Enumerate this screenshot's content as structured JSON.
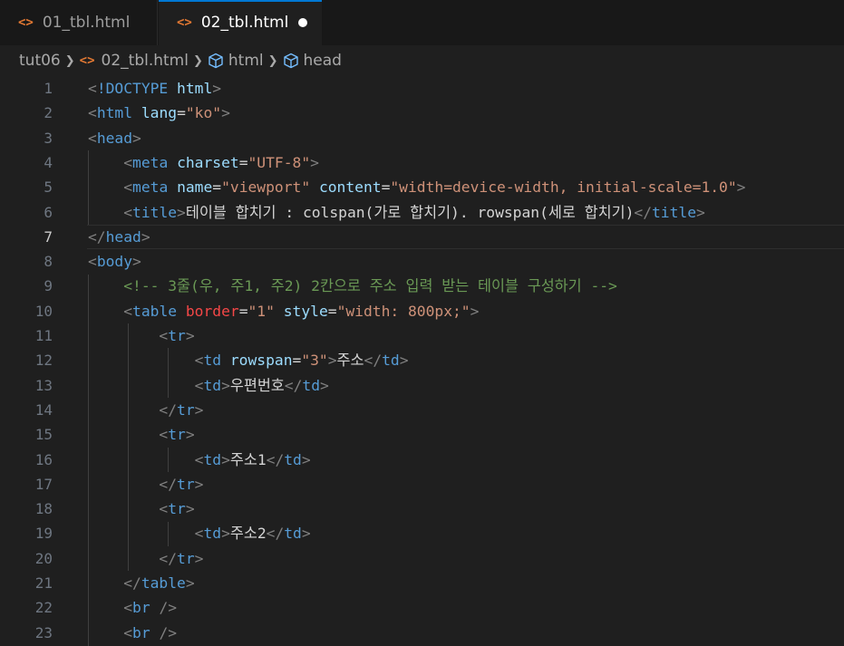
{
  "tabs": [
    {
      "icon": "<>",
      "label": "01_tbl.html",
      "active": false,
      "modified": false
    },
    {
      "icon": "<>",
      "label": "02_tbl.html",
      "active": true,
      "modified": true
    }
  ],
  "breadcrumb": {
    "folder": "tut06",
    "file": "02_tbl.html",
    "symbols": [
      "html",
      "head"
    ]
  },
  "colors": {
    "background": "#1f1f1f",
    "tag": "#569cd6",
    "attribute": "#9cdcfe",
    "string": "#ce9178",
    "comment": "#6a9955",
    "bracket": "#808080",
    "file_icon": "#e37933",
    "symbol_icon": "#75beff"
  },
  "editor": {
    "active_line": 7,
    "lines": [
      {
        "n": "1",
        "tokens": [
          [
            "br",
            "<"
          ],
          [
            "tag",
            "!DOCTYPE"
          ],
          [
            "txt",
            " "
          ],
          [
            "attr",
            "html"
          ],
          [
            "br",
            ">"
          ]
        ]
      },
      {
        "n": "2",
        "tokens": [
          [
            "br",
            "<"
          ],
          [
            "tag",
            "html"
          ],
          [
            "txt",
            " "
          ],
          [
            "attr",
            "lang"
          ],
          [
            "txt",
            "="
          ],
          [
            "str",
            "\"ko\""
          ],
          [
            "br",
            ">"
          ]
        ]
      },
      {
        "n": "3",
        "tokens": [
          [
            "br",
            "<"
          ],
          [
            "tag",
            "head"
          ],
          [
            "br",
            ">"
          ]
        ]
      },
      {
        "n": "4",
        "tokens": [
          [
            "txt",
            "    "
          ],
          [
            "br",
            "<"
          ],
          [
            "tag",
            "meta"
          ],
          [
            "txt",
            " "
          ],
          [
            "attr",
            "charset"
          ],
          [
            "txt",
            "="
          ],
          [
            "str",
            "\"UTF-8\""
          ],
          [
            "br",
            ">"
          ]
        ]
      },
      {
        "n": "5",
        "tokens": [
          [
            "txt",
            "    "
          ],
          [
            "br",
            "<"
          ],
          [
            "tag",
            "meta"
          ],
          [
            "txt",
            " "
          ],
          [
            "attr",
            "name"
          ],
          [
            "txt",
            "="
          ],
          [
            "str",
            "\"viewport\""
          ],
          [
            "txt",
            " "
          ],
          [
            "attr",
            "content"
          ],
          [
            "txt",
            "="
          ],
          [
            "str",
            "\"width=device-width, initial-scale=1.0\""
          ],
          [
            "br",
            ">"
          ]
        ]
      },
      {
        "n": "6",
        "tokens": [
          [
            "txt",
            "    "
          ],
          [
            "br",
            "<"
          ],
          [
            "tag",
            "title"
          ],
          [
            "br",
            ">"
          ],
          [
            "txt",
            "테이블 합치기 : colspan(가로 합치기). rowspan(세로 합치기)"
          ],
          [
            "br",
            "</"
          ],
          [
            "tag",
            "title"
          ],
          [
            "br",
            ">"
          ]
        ]
      },
      {
        "n": "7",
        "tokens": [
          [
            "br",
            "</"
          ],
          [
            "tag",
            "head"
          ],
          [
            "br",
            ">"
          ]
        ]
      },
      {
        "n": "8",
        "tokens": [
          [
            "br",
            "<"
          ],
          [
            "tag",
            "body"
          ],
          [
            "br",
            ">"
          ]
        ]
      },
      {
        "n": "9",
        "tokens": [
          [
            "txt",
            "    "
          ],
          [
            "com",
            "<!-- 3줄(우, 주1, 주2) 2칸으로 주소 입력 받는 테이블 구성하기 -->"
          ]
        ]
      },
      {
        "n": "10",
        "tokens": [
          [
            "txt",
            "    "
          ],
          [
            "br",
            "<"
          ],
          [
            "tag",
            "table"
          ],
          [
            "txt",
            " "
          ],
          [
            "red",
            "border"
          ],
          [
            "txt",
            "="
          ],
          [
            "str",
            "\"1\""
          ],
          [
            "txt",
            " "
          ],
          [
            "attr",
            "style"
          ],
          [
            "txt",
            "="
          ],
          [
            "str",
            "\"width: 800px;\""
          ],
          [
            "br",
            ">"
          ]
        ]
      },
      {
        "n": "11",
        "tokens": [
          [
            "txt",
            "        "
          ],
          [
            "br",
            "<"
          ],
          [
            "tag",
            "tr"
          ],
          [
            "br",
            ">"
          ]
        ]
      },
      {
        "n": "12",
        "tokens": [
          [
            "txt",
            "            "
          ],
          [
            "br",
            "<"
          ],
          [
            "tag",
            "td"
          ],
          [
            "txt",
            " "
          ],
          [
            "attr",
            "rowspan"
          ],
          [
            "txt",
            "="
          ],
          [
            "str",
            "\"3\""
          ],
          [
            "br",
            ">"
          ],
          [
            "txt",
            "주소"
          ],
          [
            "br",
            "</"
          ],
          [
            "tag",
            "td"
          ],
          [
            "br",
            ">"
          ]
        ]
      },
      {
        "n": "13",
        "tokens": [
          [
            "txt",
            "            "
          ],
          [
            "br",
            "<"
          ],
          [
            "tag",
            "td"
          ],
          [
            "br",
            ">"
          ],
          [
            "txt",
            "우편번호"
          ],
          [
            "br",
            "</"
          ],
          [
            "tag",
            "td"
          ],
          [
            "br",
            ">"
          ]
        ]
      },
      {
        "n": "14",
        "tokens": [
          [
            "txt",
            "        "
          ],
          [
            "br",
            "</"
          ],
          [
            "tag",
            "tr"
          ],
          [
            "br",
            ">"
          ]
        ]
      },
      {
        "n": "15",
        "tokens": [
          [
            "txt",
            "        "
          ],
          [
            "br",
            "<"
          ],
          [
            "tag",
            "tr"
          ],
          [
            "br",
            ">"
          ]
        ]
      },
      {
        "n": "16",
        "tokens": [
          [
            "txt",
            "            "
          ],
          [
            "br",
            "<"
          ],
          [
            "tag",
            "td"
          ],
          [
            "br",
            ">"
          ],
          [
            "txt",
            "주소1"
          ],
          [
            "br",
            "</"
          ],
          [
            "tag",
            "td"
          ],
          [
            "br",
            ">"
          ]
        ]
      },
      {
        "n": "17",
        "tokens": [
          [
            "txt",
            "        "
          ],
          [
            "br",
            "</"
          ],
          [
            "tag",
            "tr"
          ],
          [
            "br",
            ">"
          ]
        ]
      },
      {
        "n": "18",
        "tokens": [
          [
            "txt",
            "        "
          ],
          [
            "br",
            "<"
          ],
          [
            "tag",
            "tr"
          ],
          [
            "br",
            ">"
          ]
        ]
      },
      {
        "n": "19",
        "tokens": [
          [
            "txt",
            "            "
          ],
          [
            "br",
            "<"
          ],
          [
            "tag",
            "td"
          ],
          [
            "br",
            ">"
          ],
          [
            "txt",
            "주소2"
          ],
          [
            "br",
            "</"
          ],
          [
            "tag",
            "td"
          ],
          [
            "br",
            ">"
          ]
        ]
      },
      {
        "n": "20",
        "tokens": [
          [
            "txt",
            "        "
          ],
          [
            "br",
            "</"
          ],
          [
            "tag",
            "tr"
          ],
          [
            "br",
            ">"
          ]
        ]
      },
      {
        "n": "21",
        "tokens": [
          [
            "txt",
            "    "
          ],
          [
            "br",
            "</"
          ],
          [
            "tag",
            "table"
          ],
          [
            "br",
            ">"
          ]
        ]
      },
      {
        "n": "22",
        "tokens": [
          [
            "txt",
            "    "
          ],
          [
            "br",
            "<"
          ],
          [
            "tag",
            "br"
          ],
          [
            "txt",
            " "
          ],
          [
            "br",
            "/>"
          ]
        ]
      },
      {
        "n": "23",
        "tokens": [
          [
            "txt",
            "    "
          ],
          [
            "br",
            "<"
          ],
          [
            "tag",
            "br"
          ],
          [
            "txt",
            " "
          ],
          [
            "br",
            "/>"
          ]
        ]
      }
    ]
  }
}
